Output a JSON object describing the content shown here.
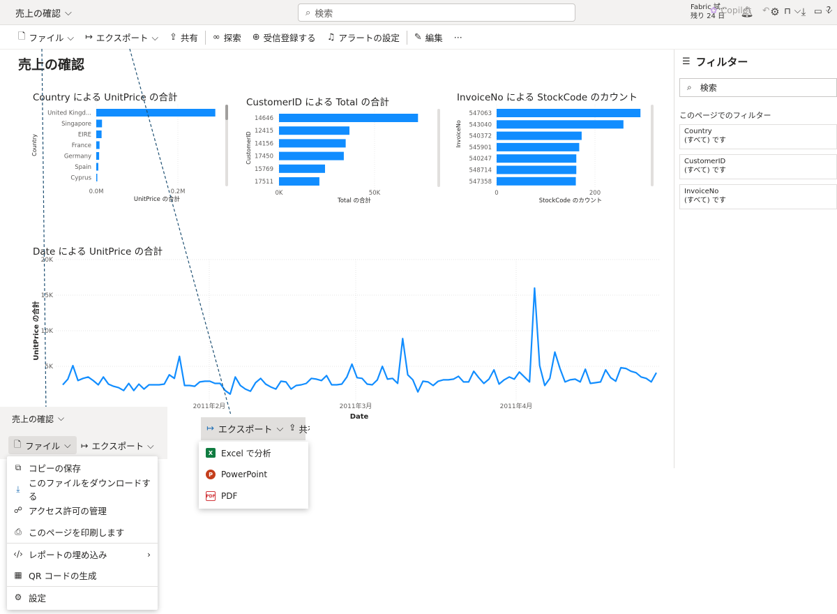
{
  "app": {
    "title": "売上の確認",
    "search_placeholder": "検索",
    "trial_line1": "Fabric 試...",
    "trial_line2": "残り 24 日"
  },
  "toolbar": {
    "file": "ファイル",
    "export": "エクスポート",
    "share": "共有",
    "explore": "探索",
    "subscribe": "受信登録する",
    "alert": "アラートの設定",
    "edit": "編集",
    "more": "···",
    "copilot": "Copilot"
  },
  "page": {
    "title": "売上の確認"
  },
  "visuals": {
    "country": {
      "title": "Country による UnitPrice の合計",
      "ylabel": "Country",
      "xlabel": "UnitPrice の合計",
      "ticks": [
        "0.0M",
        "0.2M"
      ]
    },
    "customer": {
      "title": "CustomerID による Total の合計",
      "ylabel": "CustomerID",
      "xlabel": "Total の合計",
      "ticks": [
        "0K",
        "50K"
      ]
    },
    "invoice": {
      "title": "InvoiceNo による StockCode のカウント",
      "ylabel": "InvoiceNo",
      "xlabel": "StockCode のカウント",
      "ticks": [
        "0",
        "200"
      ]
    },
    "date": {
      "title": "Date による UnitPrice の合計",
      "ylabel": "UnitPrice の合計",
      "xlabel": "Date",
      "yticks": [
        "20K",
        "15K",
        "10K",
        "5K"
      ],
      "xticks": [
        "2011年2月",
        "2011年3月",
        "2011年4月"
      ]
    }
  },
  "chart_data": [
    {
      "type": "bar",
      "title": "Country による UnitPrice の合計",
      "categories": [
        "United Kingd...",
        "Singapore",
        "EIRE",
        "France",
        "Germany",
        "Spain",
        "Cyprus"
      ],
      "values": [
        0.29,
        0.014,
        0.013,
        0.008,
        0.007,
        0.005,
        0.002
      ],
      "xlim": [
        0,
        0.35
      ],
      "unit": "M"
    },
    {
      "type": "bar",
      "title": "CustomerID による Total の合計",
      "categories": [
        "14646",
        "12415",
        "14156",
        "17450",
        "15769",
        "17511"
      ],
      "values": [
        74000,
        37500,
        35500,
        34500,
        24500,
        21500
      ],
      "xlim": [
        0,
        75000
      ]
    },
    {
      "type": "bar",
      "title": "InvoiceNo による StockCode のカウント",
      "categories": [
        "547063",
        "543040",
        "540372",
        "545901",
        "540247",
        "548714",
        "547358"
      ],
      "values": [
        296,
        261,
        175,
        170,
        164,
        164,
        163
      ],
      "xlim": [
        0,
        300
      ]
    },
    {
      "type": "line",
      "title": "Date による UnitPrice の合計",
      "ylim": [
        0,
        20000
      ],
      "values": [
        2400,
        3200,
        5100,
        3000,
        3300,
        3500,
        3000,
        2400,
        3500,
        2500,
        2200,
        2000,
        1600,
        2600,
        1600,
        2500,
        1800,
        2400,
        2400,
        2400,
        2500,
        3800,
        3300,
        6400,
        2300,
        2300,
        2200,
        2800,
        2900,
        2900,
        2600,
        2600,
        1600,
        1100,
        3500,
        2300,
        1800,
        1500,
        2700,
        3300,
        2500,
        2100,
        1800,
        2900,
        2800,
        1800,
        2300,
        2400,
        2600,
        3300,
        3200,
        3000,
        3700,
        2400,
        2400,
        2500,
        3500,
        5300,
        3400,
        3300,
        2500,
        2400,
        3100,
        5000,
        3200,
        3300,
        2600,
        8900,
        3800,
        3100,
        1400,
        2900,
        2800,
        2300,
        2900,
        3100,
        3100,
        3200,
        3600,
        2800,
        2800,
        4300,
        3400,
        2600,
        3200,
        4500,
        2500,
        3100,
        3500,
        3200,
        4200,
        3500,
        2800,
        16000,
        5100,
        2300,
        3300,
        7000,
        4700,
        2800,
        3100,
        3200,
        2800,
        4600,
        2600,
        2700,
        2800,
        4500,
        3400,
        2900,
        4800,
        4700,
        4300,
        4100,
        3500,
        3300,
        2800,
        4100
      ]
    }
  ],
  "filter_pane": {
    "title": "フィルター",
    "search": "検索",
    "subtitle": "このページでのフィルター",
    "cards": [
      {
        "name": "Country",
        "value": "(すべて) です"
      },
      {
        "name": "CustomerID",
        "value": "(すべて) です"
      },
      {
        "name": "InvoiceNo",
        "value": "(すべて) です"
      }
    ]
  },
  "file_menu": {
    "title": "売上の確認",
    "file": "ファイル",
    "export": "エクスポート",
    "items": [
      "コピーの保存",
      "このファイルをダウンロードする",
      "アクセス許可の管理",
      "このページを印刷します",
      "レポートの埋め込み",
      "QR コードの生成",
      "設定"
    ]
  },
  "export_menu": {
    "export": "エクスポート",
    "share": "共有",
    "items": [
      "Excel で分析",
      "PowerPoint",
      "PDF"
    ]
  }
}
